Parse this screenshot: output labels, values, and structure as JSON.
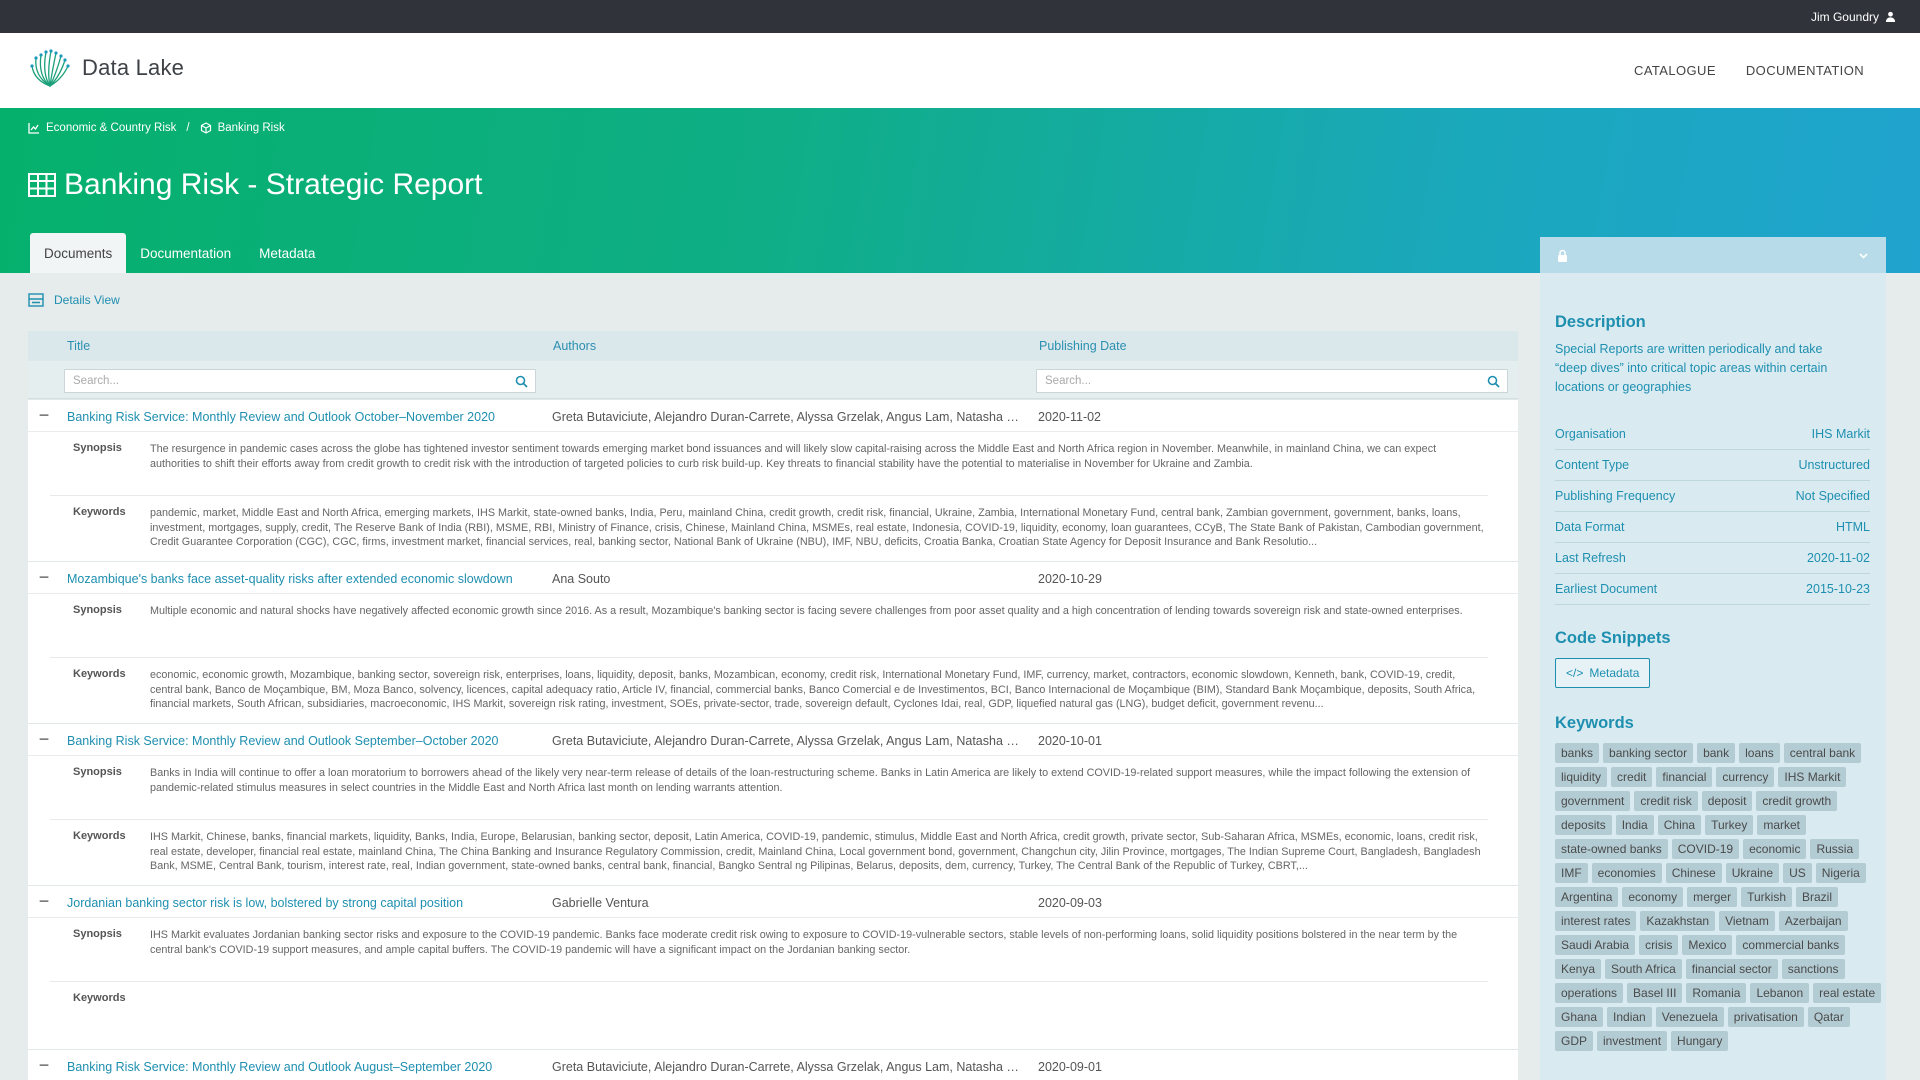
{
  "topbar": {
    "user_name": "Jim Goundry"
  },
  "header": {
    "brand_name": "Data Lake",
    "nav": [
      {
        "label": "CATALOGUE"
      },
      {
        "label": "DOCUMENTATION"
      }
    ]
  },
  "breadcrumb": [
    {
      "label": "Economic & Country Risk"
    },
    {
      "label": "Banking Risk"
    }
  ],
  "page": {
    "title": "Banking Risk - Strategic Report"
  },
  "tabs": [
    {
      "label": "Documents"
    },
    {
      "label": "Documentation"
    },
    {
      "label": "Metadata"
    }
  ],
  "view_toggle": {
    "label": "Details View"
  },
  "table": {
    "columns": [
      {
        "label": "Title"
      },
      {
        "label": "Authors"
      },
      {
        "label": "Publishing Date"
      }
    ],
    "search_placeholder": "Search...",
    "synopsis_label": "Synopsis",
    "keywords_label": "Keywords",
    "rows": [
      {
        "title": "Banking Risk Service: Monthly Review and Outlook October–November 2020",
        "authors": "Greta Butaviciute, Alejandro Duran-Carrete, Alyssa Grzelak, Angus Lam, Natasha Mc...",
        "date": "2020-11-02",
        "synopsis": "The resurgence in pandemic cases across the globe has tightened investor sentiment towards emerging market bond issuances and will likely slow capital-raising across the Middle East and North Africa region in November. Meanwhile, in mainland China, we can expect authorities to shift their efforts away from credit growth to credit risk with the introduction of targeted policies to curb risk build-up. Key threats to financial stability have the potential to materialise in November for Ukraine and Zambia.",
        "keywords": "pandemic, market, Middle East and North Africa, emerging markets, IHS Markit, state-owned banks, India, Peru, mainland China, credit growth, credit risk, financial, Ukraine, Zambia, International Monetary Fund, central bank, Zambian government, government, banks, loans, investment, mortgages, supply, credit, The Reserve Bank of India (RBI), MSME, RBI, Ministry of Finance, crisis, Chinese, Mainland China, MSMEs, real estate, Indonesia, COVID-19, liquidity, economy, loan guarantees, CCyB, The State Bank of Pakistan, Cambodian government, Credit Guarantee Corporation (CGC), CGC, firms, investment market, financial services, real, banking sector, National Bank of Ukraine (NBU), IMF, NBU, deficits, Croatia Banka, Croatian State Agency for Deposit Insurance and Bank Resolutio..."
      },
      {
        "title": "Mozambique's banks face asset-quality risks after extended economic slowdown",
        "authors": "Ana Souto",
        "date": "2020-10-29",
        "synopsis": "Multiple economic and natural shocks have negatively affected economic growth since 2016. As a result, Mozambique's banking sector is facing severe challenges from poor asset quality and a high concentration of lending towards sovereign risk and state-owned enterprises.",
        "keywords": "economic, economic growth, Mozambique, banking sector, sovereign risk, enterprises, loans, liquidity, deposit, banks, Mozambican, economy, credit risk, International Monetary Fund, IMF, currency, market, contractors, economic slowdown, Kenneth, bank, COVID-19, credit, central bank, Banco de Moçambique, BM, Moza Banco, solvency, licences, capital adequacy ratio, Article IV, financial, commercial banks, Banco Comercial e de Investimentos, BCI, Banco Internacional de Moçambique (BIM), Standard Bank Moçambique, deposits, South Africa, financial markets, South African, subsidiaries, macroeconomic, IHS Markit, sovereign risk rating, investment, SOEs, private-sector, trade, sovereign default, Cyclones Idai, real, GDP, liquefied natural gas (LNG), budget deficit, government revenu..."
      },
      {
        "title": "Banking Risk Service: Monthly Review and Outlook September–October 2020",
        "authors": "Greta Butaviciute, Alejandro Duran-Carrete, Alyssa Grzelak, Angus Lam, Natasha Mc...",
        "date": "2020-10-01",
        "synopsis": "Banks in India will continue to offer a loan moratorium to borrowers ahead of the likely very near-term release of details of the loan-restructuring scheme. Banks in Latin America are likely to extend COVID-19-related support measures, while the impact following the extension of pandemic-related stimulus measures in select countries in the Middle East and North Africa last month on lending warrants attention.",
        "keywords": "IHS Markit, Chinese, banks, financial markets, liquidity, Banks, India, Europe, Belarusian, banking sector, deposit, Latin America, COVID-19, pandemic, stimulus, Middle East and North Africa, credit growth, private sector, Sub-Saharan Africa, MSMEs, economic, loans, credit risk, real estate, developer, financial real estate, mainland China, The China Banking and Insurance Regulatory Commission, credit, Mainland China, Local government bond, government, Changchun city, Jilin Province, mortgages, The Indian Supreme Court, Bangladesh, Bangladesh Bank, MSME, Central Bank, tourism, interest rate, real, Indian government, state-owned banks, central bank, financial, Bangko Sentral ng Pilipinas, Belarus, deposits, dem, currency, Turkey, The Central Bank of the Republic of Turkey, CBRT,..."
      },
      {
        "title": "Jordanian banking sector risk is low, bolstered by strong capital position",
        "authors": "Gabrielle Ventura",
        "date": "2020-09-03",
        "synopsis": "IHS Markit evaluates Jordanian banking sector risks and exposure to the COVID-19 pandemic. Banks face moderate credit risk owing to exposure to COVID-19-vulnerable sectors, stable levels of non-performing loans, solid liquidity positions bolstered in the near term by the central bank's COVID-19 support measures, and ample capital buffers. The COVID-19 pandemic will have a significant impact on the Jordanian banking sector.",
        "keywords": ""
      },
      {
        "title": "Banking Risk Service: Monthly Review and Outlook August–September 2020",
        "authors": "Greta Butaviciute, Alejandro Duran-Carrete, Alyssa Grzelak, Angus Lam, Natasha Mc...",
        "date": "2020-09-01"
      }
    ]
  },
  "sidebar": {
    "description_title": "Description",
    "description": "Special Reports are written periodically and take “deep dives” into critical topic areas within certain locations or geographies",
    "meta": [
      {
        "label": "Organisation",
        "value": "IHS Markit"
      },
      {
        "label": "Content Type",
        "value": "Unstructured"
      },
      {
        "label": "Publishing Frequency",
        "value": "Not Specified"
      },
      {
        "label": "Data Format",
        "value": "HTML"
      },
      {
        "label": "Last Refresh",
        "value": "2020-11-02"
      },
      {
        "label": "Earliest Document",
        "value": "2015-10-23"
      }
    ],
    "snippets_title": "Code Snippets",
    "snippet_button": "Metadata",
    "keywords_title": "Keywords",
    "keywords": [
      "banks",
      "banking sector",
      "bank",
      "loans",
      "central bank",
      "liquidity",
      "credit",
      "financial",
      "currency",
      "IHS Markit",
      "government",
      "credit risk",
      "deposit",
      "credit growth",
      "deposits",
      "India",
      "China",
      "Turkey",
      "market",
      "state-owned banks",
      "COVID-19",
      "economic",
      "Russia",
      "IMF",
      "economies",
      "Chinese",
      "Ukraine",
      "US",
      "Nigeria",
      "Argentina",
      "economy",
      "merger",
      "Turkish",
      "Brazil",
      "interest rates",
      "Kazakhstan",
      "Vietnam",
      "Azerbaijan",
      "Saudi Arabia",
      "crisis",
      "Mexico",
      "commercial banks",
      "Kenya",
      "South Africa",
      "financial sector",
      "sanctions",
      "operations",
      "Basel III",
      "Romania",
      "Lebanon",
      "real estate",
      "Ghana",
      "Indian",
      "Venezuela",
      "privatisation",
      "Qatar",
      "GDP",
      "investment",
      "Hungary"
    ]
  },
  "colors": {
    "accent": "#1f8fb0",
    "topbar": "#30333a",
    "hero_start": "#05b06c",
    "hero_end": "#20a4cf",
    "sidebar": "#d9ebf1",
    "tag": "#b3ccd4"
  }
}
